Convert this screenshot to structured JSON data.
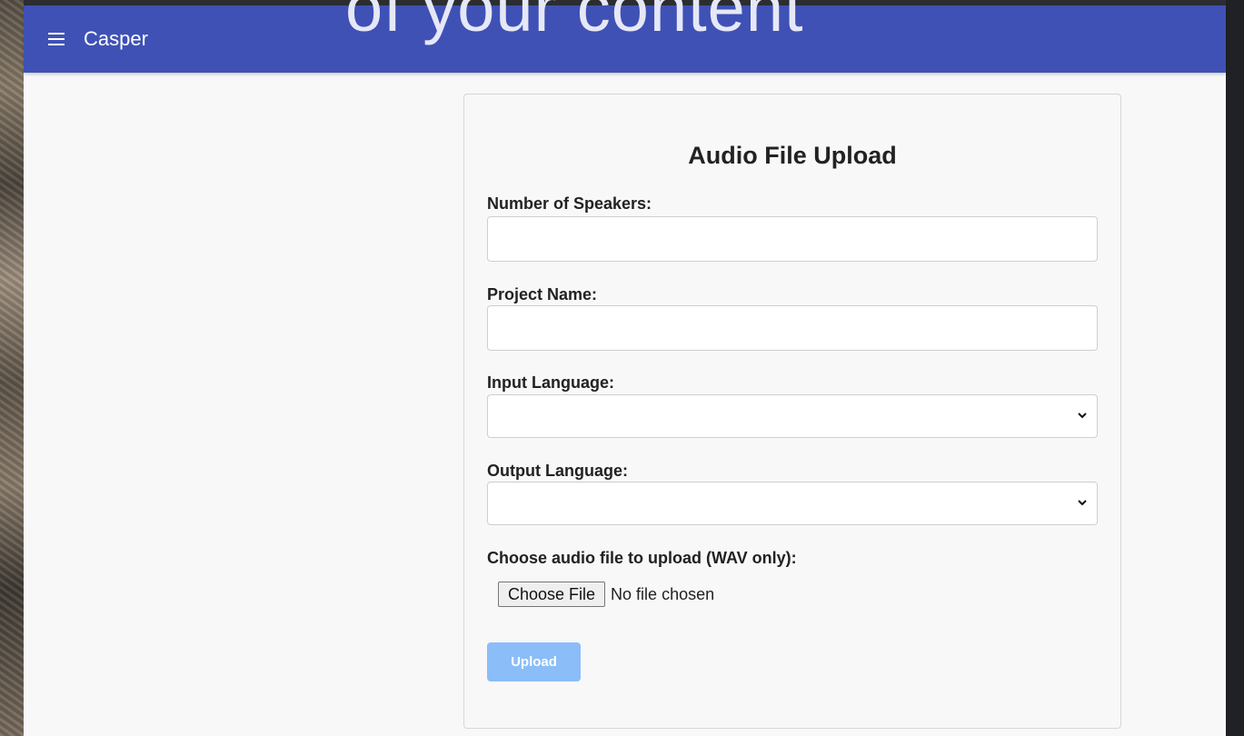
{
  "overlay": {
    "text": "of your content"
  },
  "header": {
    "menu_icon": "hamburger-menu-icon",
    "title": "Casper",
    "bar_color": "#3f51b5"
  },
  "form": {
    "title": "Audio File Upload",
    "speakers_label": "Number of Speakers:",
    "speakers_value": "",
    "project_label": "Project Name:",
    "project_value": "",
    "input_language_label": "Input Language:",
    "input_language_value": "",
    "output_language_label": "Output Language:",
    "output_language_value": "",
    "file_label": "Choose audio file to upload (WAV only):",
    "file_button": "Choose File",
    "file_status": "No file chosen",
    "upload_button": "Upload",
    "upload_color": "#8bbdf9"
  }
}
